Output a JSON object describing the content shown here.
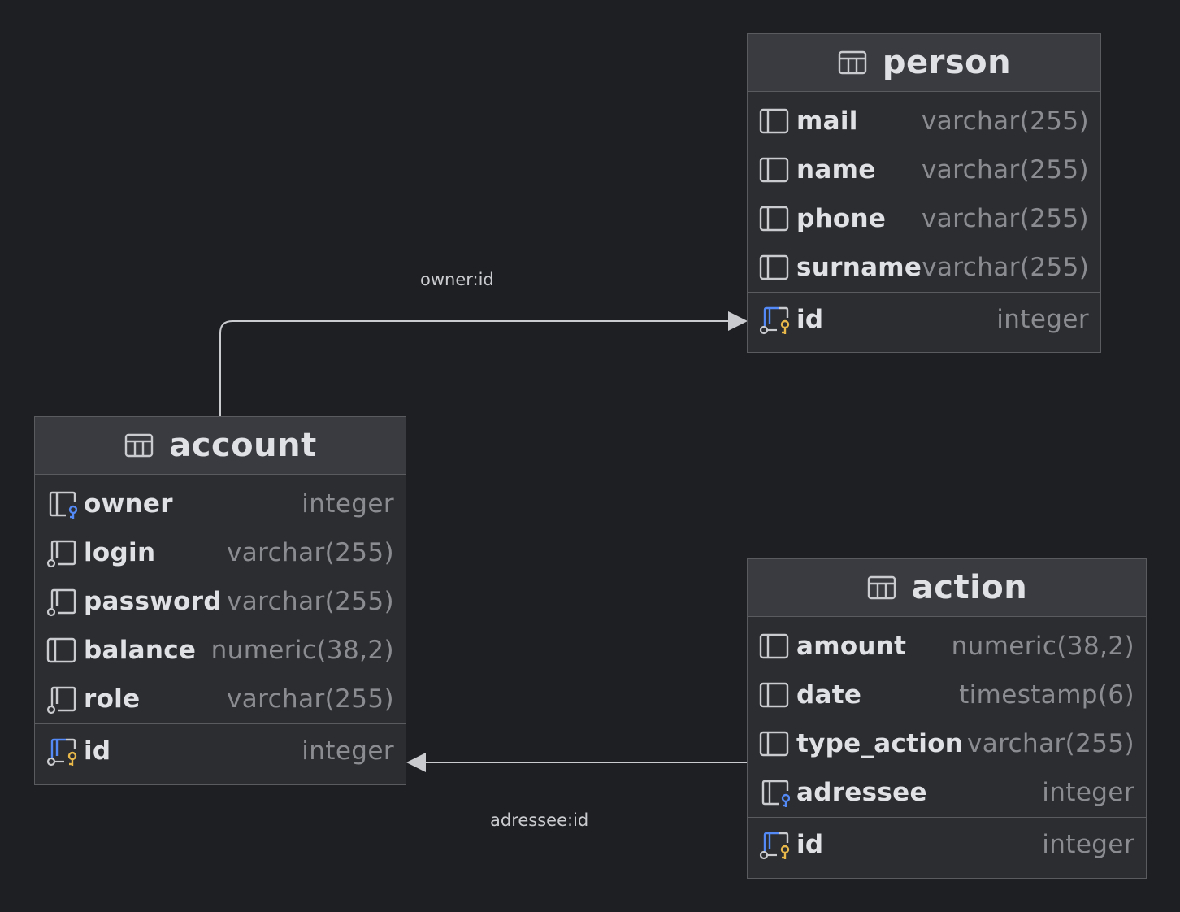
{
  "tables": {
    "person": {
      "name": "person",
      "columns": [
        {
          "name": "mail",
          "type": "varchar(255)",
          "icon": "column-icon"
        },
        {
          "name": "name",
          "type": "varchar(255)",
          "icon": "column-icon"
        },
        {
          "name": "phone",
          "type": "varchar(255)",
          "icon": "column-icon"
        },
        {
          "name": "surname",
          "type": "varchar(255)",
          "icon": "column-icon"
        }
      ],
      "pk": {
        "name": "id",
        "type": "integer",
        "icon": "primary-key-icon"
      }
    },
    "account": {
      "name": "account",
      "columns": [
        {
          "name": "owner",
          "type": "integer",
          "icon": "foreign-key-icon"
        },
        {
          "name": "login",
          "type": "varchar(255)",
          "icon": "not-null-column-icon"
        },
        {
          "name": "password",
          "type": "varchar(255)",
          "icon": "not-null-column-icon"
        },
        {
          "name": "balance",
          "type": "numeric(38,2)",
          "icon": "column-icon"
        },
        {
          "name": "role",
          "type": "varchar(255)",
          "icon": "not-null-column-icon"
        }
      ],
      "pk": {
        "name": "id",
        "type": "integer",
        "icon": "primary-key-icon"
      }
    },
    "action": {
      "name": "action",
      "columns": [
        {
          "name": "amount",
          "type": "numeric(38,2)",
          "icon": "column-icon"
        },
        {
          "name": "date",
          "type": "timestamp(6)",
          "icon": "column-icon"
        },
        {
          "name": "type_action",
          "type": "varchar(255)",
          "icon": "column-icon"
        },
        {
          "name": "adressee",
          "type": "integer",
          "icon": "foreign-key-icon"
        }
      ],
      "pk": {
        "name": "id",
        "type": "integer",
        "icon": "primary-key-icon"
      }
    }
  },
  "relations": [
    {
      "label": "owner:id",
      "from": "account",
      "to": "person"
    },
    {
      "label": "adressee:id",
      "from": "action",
      "to": "account"
    }
  ],
  "colors": {
    "background": "#1e1f22",
    "table_body": "#2b2d30",
    "table_header": "#393b40",
    "border": "#595b5f",
    "key_gold": "#e8b84b",
    "fk_blue": "#548af7",
    "edge": "#c9cbcf"
  }
}
